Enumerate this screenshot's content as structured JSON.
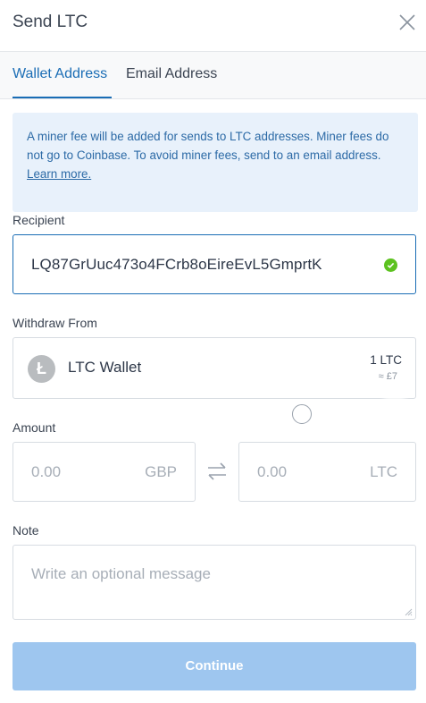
{
  "header": {
    "title": "Send LTC",
    "close_icon": "close-icon"
  },
  "tabs": [
    {
      "label": "Wallet Address",
      "active": true
    },
    {
      "label": "Email Address",
      "active": false
    }
  ],
  "notice": {
    "text": "A miner fee will be added for sends to LTC addresses. Miner fees do not go to Coinbase. To avoid miner fees, send to an email address.",
    "link": "Learn more."
  },
  "recipient": {
    "label": "Recipient",
    "value": "LQ87GrUuc473o4FCrb8oEireEvL5GmprtK",
    "valid": true
  },
  "withdraw": {
    "label": "Withdraw From",
    "wallet_name": "LTC Wallet",
    "icon_letter": "Ł",
    "balance": "1 LTC",
    "fiat": "≈ £7"
  },
  "amount": {
    "label": "Amount",
    "fiat_value": "0.00",
    "fiat_currency": "GBP",
    "crypto_value": "0.00",
    "crypto_currency": "LTC"
  },
  "note": {
    "label": "Note",
    "placeholder": "Write an optional message"
  },
  "continue_label": "Continue",
  "colors": {
    "accent": "#1a6db5",
    "notice_bg": "#e8f1fb",
    "valid": "#5cc21f",
    "button_disabled": "#9ec6ef"
  }
}
